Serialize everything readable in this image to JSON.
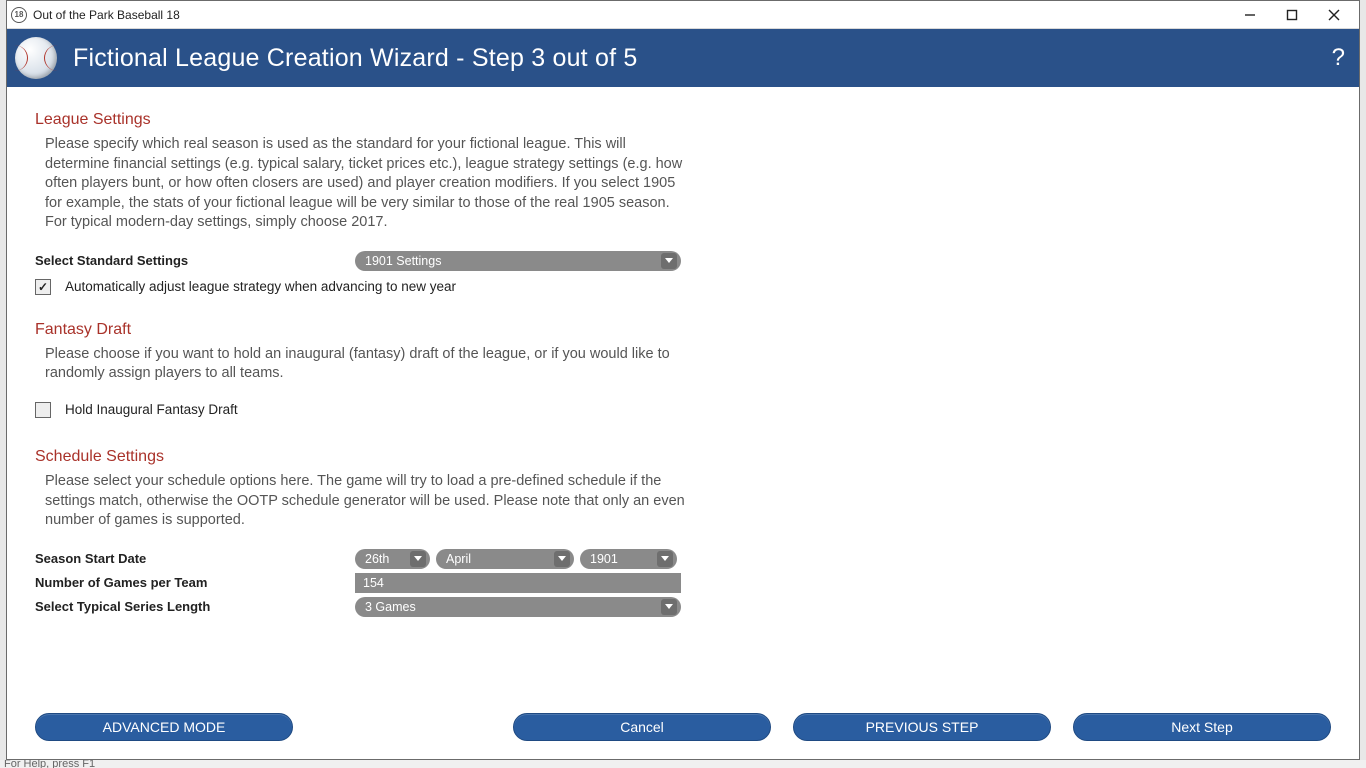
{
  "window": {
    "title": "Out of the Park Baseball 18",
    "app_icon_text": "18"
  },
  "header": {
    "title": "Fictional League Creation Wizard - Step 3 out of 5",
    "help": "?"
  },
  "sections": {
    "league": {
      "title": "League Settings",
      "desc": "Please specify which real season is used as the standard for your fictional league. This will determine financial settings (e.g. typical salary, ticket prices etc.), league strategy settings (e.g. how often players bunt, or how often closers are used) and player creation modifiers. If you select 1905 for example, the stats of your fictional league will be very similar to those of the real 1905 season. For typical modern-day settings, simply choose 2017.",
      "select_label": "Select Standard Settings",
      "select_value": "1901 Settings",
      "checkbox_label": "Automatically adjust league strategy when advancing to new year",
      "checkbox_checked": true
    },
    "draft": {
      "title": "Fantasy Draft",
      "desc": "Please choose if you want to hold an inaugural (fantasy) draft of the league, or if you would like to randomly assign players to all teams.",
      "checkbox_label": "Hold Inaugural Fantasy Draft",
      "checkbox_checked": false
    },
    "schedule": {
      "title": "Schedule Settings",
      "desc": "Please select your schedule options here. The game will try to load a pre-defined schedule if the settings match, otherwise the OOTP schedule generator will be used. Please note that only an even number of games is supported.",
      "start_label": "Season Start Date",
      "start_day": "26th",
      "start_month": "April",
      "start_year": "1901",
      "games_label": "Number of Games per Team",
      "games_value": "154",
      "series_label": "Select Typical Series Length",
      "series_value": "3 Games"
    }
  },
  "buttons": {
    "advanced": "ADVANCED MODE",
    "cancel": "Cancel",
    "prev": "PREVIOUS STEP",
    "next": "Next Step"
  },
  "status_scrap": "For Help, press F1"
}
